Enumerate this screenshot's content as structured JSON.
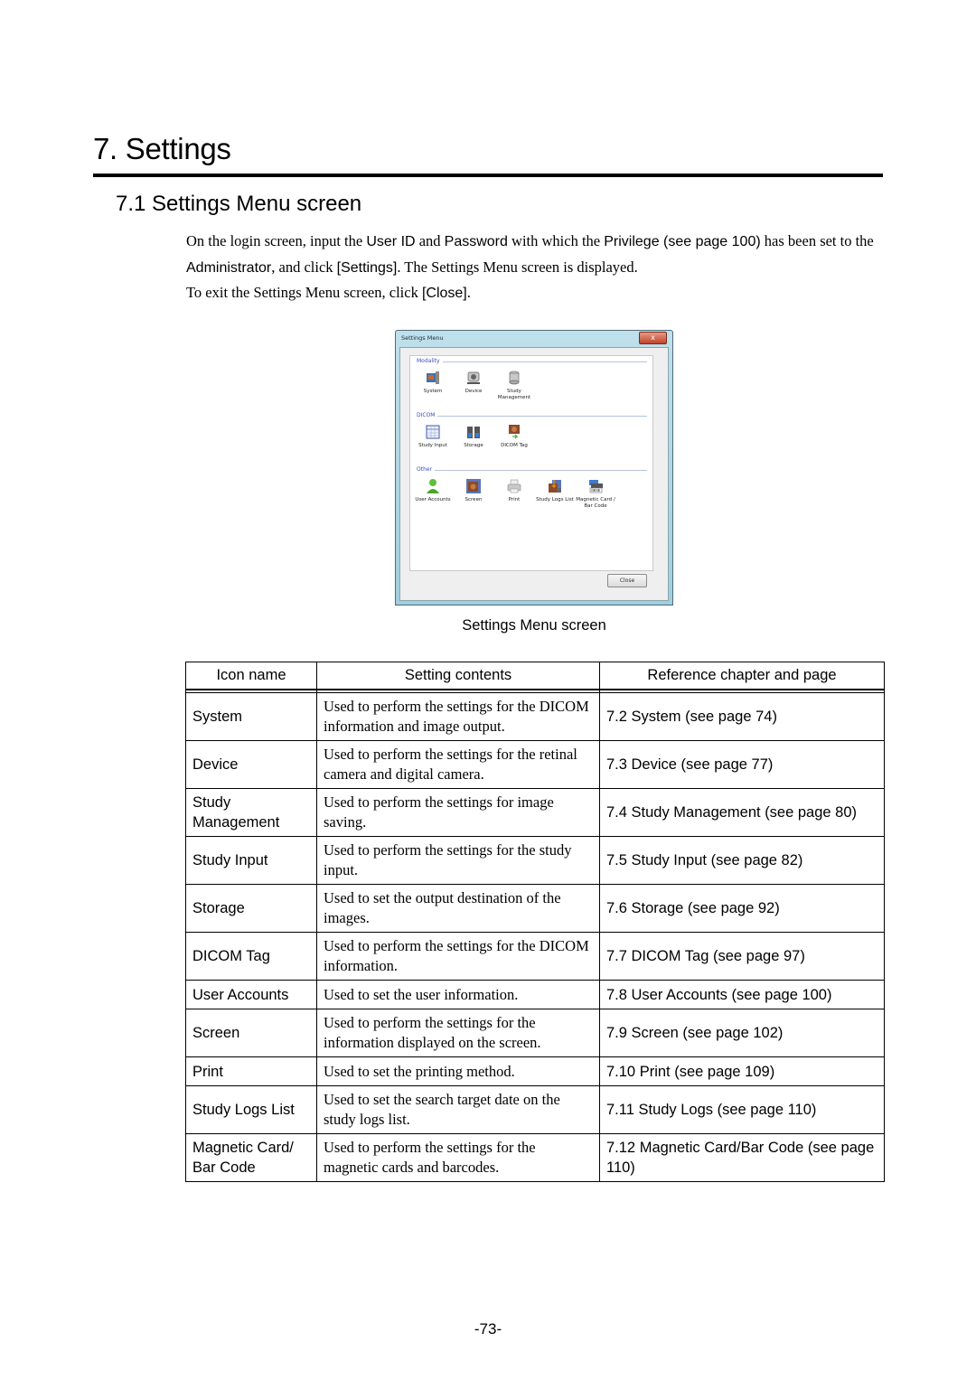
{
  "chapter": {
    "title": "7. Settings"
  },
  "section": {
    "title": "7.1 Settings Menu screen"
  },
  "intro": {
    "line1_a": "On the login screen, input the ",
    "line1_userid": "User ID",
    "line1_b": " and ",
    "line1_password": "Password",
    "line1_c": " with which the ",
    "line1_privilege": "Privilege (see page 100)",
    "line1_d": " has been set to the ",
    "line2_admin": "Administrator",
    "line2_a": ", and click ",
    "line2_settings": "[Settings]",
    "line2_b": ".  The Settings Menu screen is displayed.",
    "line3_a": "To exit the Settings Menu screen, click ",
    "line3_close": "[Close]",
    "line3_b": "."
  },
  "window": {
    "title": "Settings Menu",
    "close_glyph": "x",
    "groups": [
      {
        "label": "Modality",
        "items": [
          {
            "label": "System",
            "icon": "system-icon"
          },
          {
            "label": "Device",
            "icon": "device-icon"
          },
          {
            "label": "Study Management",
            "icon": "database-icon"
          }
        ]
      },
      {
        "label": "DICOM",
        "items": [
          {
            "label": "Study Input",
            "icon": "table-icon"
          },
          {
            "label": "Storage",
            "icon": "storage-icon"
          },
          {
            "label": "DICOM Tag",
            "icon": "dicom-tag-icon"
          }
        ]
      },
      {
        "label": "Other",
        "items": [
          {
            "label": "User Accounts",
            "icon": "user-icon"
          },
          {
            "label": "Screen",
            "icon": "screen-icon"
          },
          {
            "label": "Print",
            "icon": "printer-icon"
          },
          {
            "label": "Study Logs List",
            "icon": "study-logs-icon"
          },
          {
            "label": "Magnetic Card / Bar Code",
            "icon": "card-reader-icon"
          }
        ]
      }
    ],
    "close_button": "Close"
  },
  "caption": "Settings Menu screen",
  "table": {
    "headers": [
      "Icon name",
      "Setting contents",
      "Reference chapter and page"
    ],
    "rows": [
      {
        "name": "System",
        "desc": "Used to perform the settings for the DICOM information and image output.",
        "ref": "7.2 System (see page 74)"
      },
      {
        "name": "Device",
        "desc": "Used to perform the settings for the retinal camera and digital camera.",
        "ref": "7.3 Device (see page 77)"
      },
      {
        "name": "Study Management",
        "desc": "Used to perform the settings for image saving.",
        "ref": "7.4 Study Management (see page 80)"
      },
      {
        "name": "Study Input",
        "desc": "Used to perform the settings for the study input.",
        "ref": "7.5 Study Input (see page 82)"
      },
      {
        "name": "Storage",
        "desc": "Used to set the output destination of the images.",
        "ref": "7.6 Storage (see page 92)"
      },
      {
        "name": "DICOM Tag",
        "desc": "Used to perform the settings for the DICOM information.",
        "ref": "7.7 DICOM Tag (see page 97)"
      },
      {
        "name": "User Accounts",
        "desc": "Used to set the user information.",
        "ref": "7.8 User Accounts (see page 100)"
      },
      {
        "name": "Screen",
        "desc": "Used to perform the settings for the information displayed on the screen.",
        "ref": "7.9 Screen (see page 102)"
      },
      {
        "name": "Print",
        "desc": "Used to set the printing method.",
        "ref": "7.10 Print (see page 109)"
      },
      {
        "name": "Study Logs List",
        "desc": "Used to set the search target date on the study logs list.",
        "ref": "7.11 Study Logs (see page 110)"
      },
      {
        "name": "Magnetic Card/ Bar Code",
        "desc": "Used to perform the settings for the magnetic cards and barcodes.",
        "ref": "7.12 Magnetic Card/Bar Code (see page 110)"
      }
    ]
  },
  "page_number": "-73-"
}
